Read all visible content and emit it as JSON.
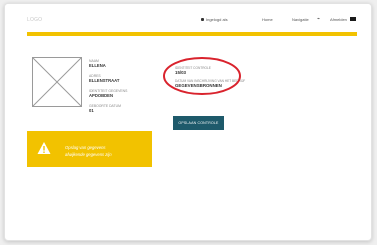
{
  "header": {
    "logo": "LOGO",
    "nav": [
      {
        "label": "Ingelogd als",
        "icon": "user-icon"
      },
      {
        "label": "Home"
      },
      {
        "label": "Navigatie"
      },
      {
        "label": "Afmelden"
      }
    ],
    "language_icon": "globe-icon",
    "flag_icon": "flag-icon"
  },
  "colors": {
    "accent": "#f2c200",
    "button": "#1e5a6b",
    "highlight": "#d9232d"
  },
  "profile": {
    "photo_icon": "image-placeholder-icon",
    "fields": [
      {
        "label": "NAAM",
        "value": "ELLENA"
      },
      {
        "label": "ADRES",
        "value": "ELLENSTRAAT"
      },
      {
        "label": "IDENTITEIT GEGEVENS",
        "value": "APDOBDEN"
      },
      {
        "label": "GEBOORTE DATUM",
        "value": "01"
      }
    ]
  },
  "alert": {
    "icon": "warning-icon",
    "lines": [
      "Opslag van gegevens",
      "afwijkende gegevens zijn"
    ]
  },
  "details": {
    "items": [
      {
        "label": "IDENTITEIT CONTROLE",
        "value": "15/03"
      },
      {
        "label": "DATUM VAN INSCHRIJVING VAN HET BEDRIJF",
        "value": "GEGEVENSBRONNEN"
      }
    ]
  },
  "actions": {
    "primary_label": "OPSLAAN CONTROLE"
  }
}
